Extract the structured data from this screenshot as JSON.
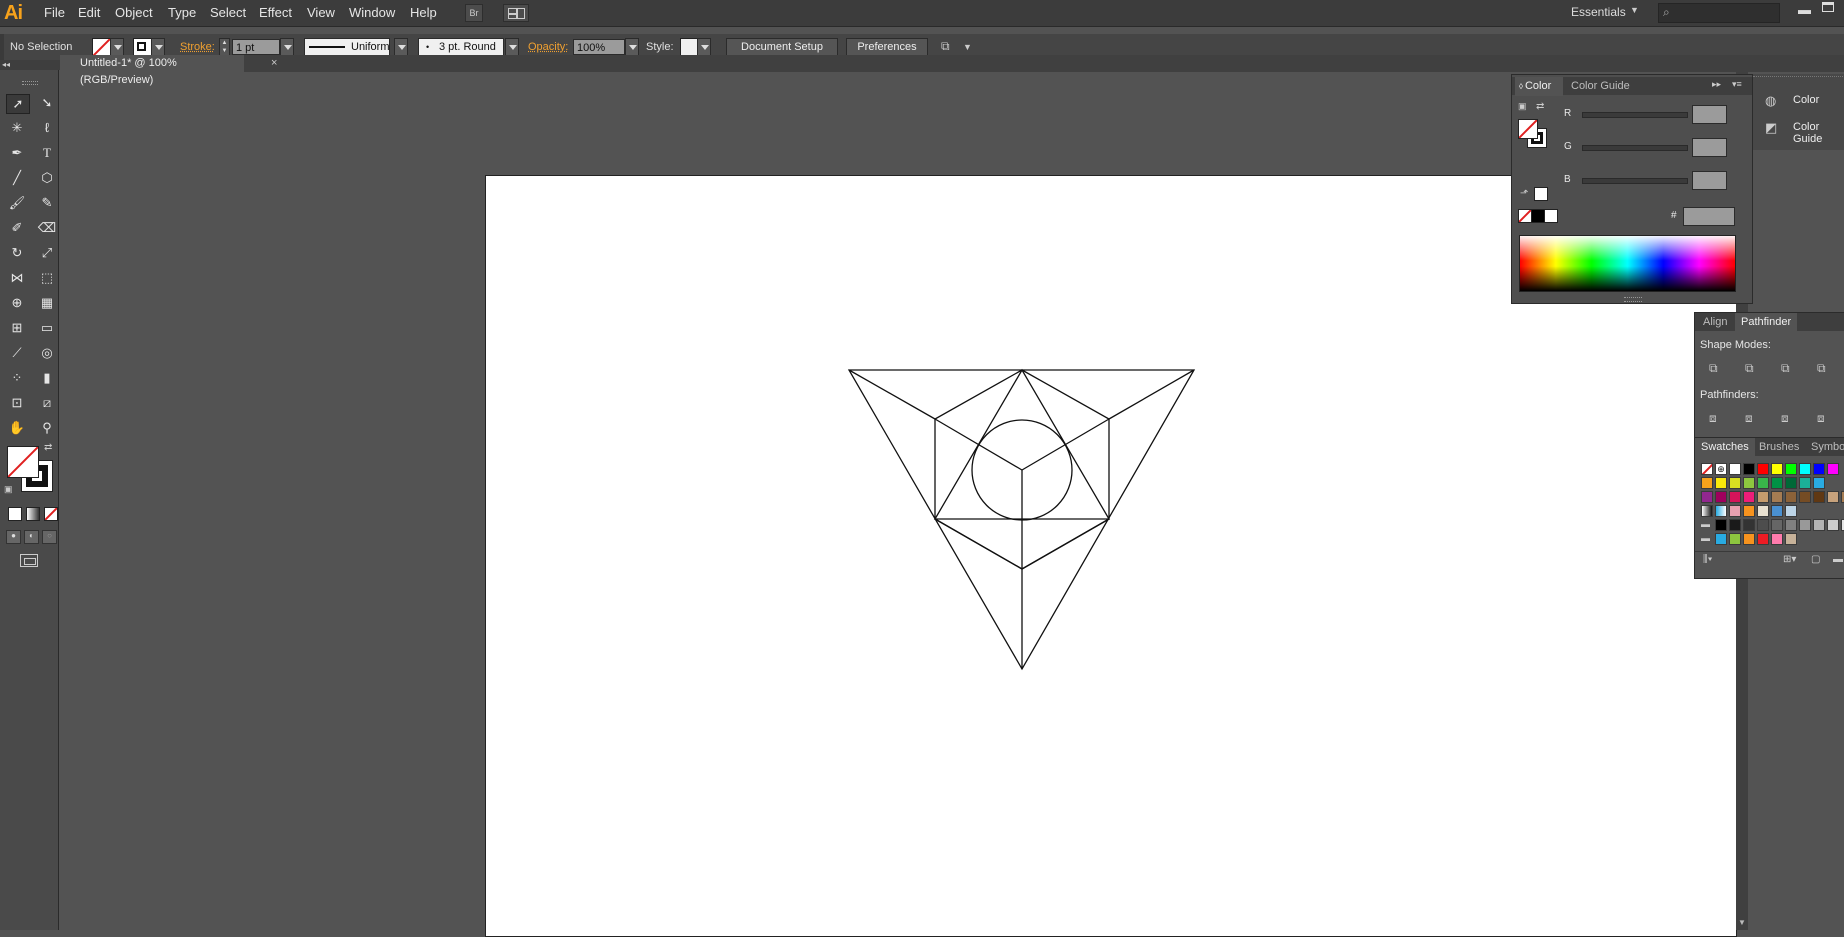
{
  "app": {
    "logo": "Ai"
  },
  "menu": [
    "File",
    "Edit",
    "Object",
    "Type",
    "Select",
    "Effect",
    "View",
    "Window",
    "Help"
  ],
  "topbar": {
    "workspace": "Essentials",
    "search_placeholder": ""
  },
  "control": {
    "selection": "No Selection",
    "stroke_label": "Stroke:",
    "stroke_value": "1 pt",
    "profile": "Uniform",
    "brush": "3 pt. Round",
    "opacity_label": "Opacity:",
    "opacity_value": "100%",
    "style_label": "Style:",
    "document_setup": "Document Setup",
    "preferences": "Preferences"
  },
  "document": {
    "tab": "Untitled-1* @ 100% (RGB/Preview)",
    "close": "×"
  },
  "color_panel": {
    "tabs": [
      "Color",
      "Color Guide"
    ],
    "r": "R",
    "g": "G",
    "b": "B",
    "hex_label": "#"
  },
  "collapsed_panels": [
    "Color",
    "Color Guide"
  ],
  "pathfinder_panel": {
    "tabs": [
      "Align",
      "Pathfinder"
    ],
    "shape_modes": "Shape Modes:",
    "pathfinders": "Pathfinders:"
  },
  "swatches_panel": {
    "tabs": [
      "Swatches",
      "Brushes",
      "Symbols"
    ],
    "row1": [
      "#ffffff",
      "#000000",
      "#ff0000",
      "#ffff00",
      "#00ff00",
      "#00ffff",
      "#0000ff",
      "#ff00ff"
    ],
    "row2": [
      "#f7a21b",
      "#f9e80b",
      "#d8df21",
      "#8dc63f",
      "#39b54a",
      "#009245",
      "#006837",
      "#1bb097",
      "#29abe2"
    ],
    "row3": [
      "#92278f",
      "#9e005d",
      "#d4145a",
      "#ed1e79",
      "#c69c6d",
      "#a67c52",
      "#8c6239",
      "#754c24",
      "#603813",
      "#c7a27c",
      "#a67c52"
    ],
    "row5": [
      "#000000",
      "#1a1a1a",
      "#333333",
      "#4d4d4d",
      "#666666",
      "#808080",
      "#999999",
      "#b3b3b3",
      "#cccccc",
      "#e6e6e6",
      "#f2f2f2"
    ],
    "row6": [
      "#29abe2",
      "#8dc63f",
      "#f7931e",
      "#ed1c24",
      "#ff7bac",
      "#c7b299"
    ]
  },
  "colors": {
    "accent": "#f7a21b",
    "chrome": "#535353",
    "artboard": "#ffffff"
  }
}
